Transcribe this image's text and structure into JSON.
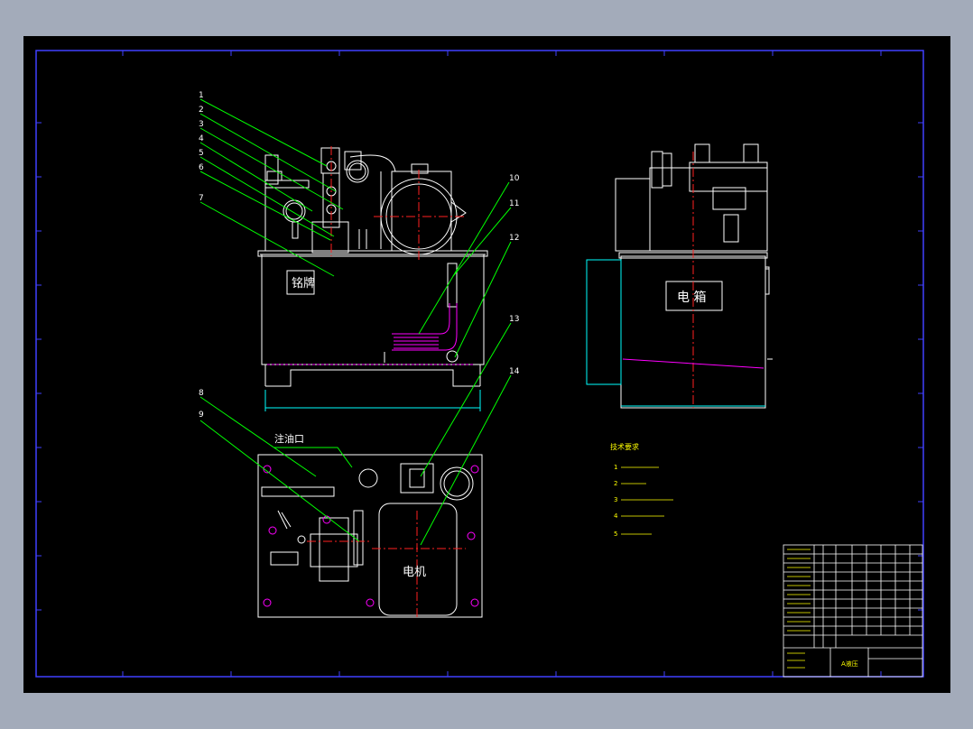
{
  "callouts": [
    {
      "n": "1"
    },
    {
      "n": "2"
    },
    {
      "n": "3"
    },
    {
      "n": "4"
    },
    {
      "n": "5"
    },
    {
      "n": "6"
    },
    {
      "n": "7"
    },
    {
      "n": "8"
    },
    {
      "n": "9"
    },
    {
      "n": "10"
    },
    {
      "n": "11"
    },
    {
      "n": "12"
    },
    {
      "n": "13"
    },
    {
      "n": "14"
    }
  ],
  "labels": {
    "nameplate": "铭牌",
    "electric_box": "电 箱",
    "motor": "电机",
    "fill_port": "注油口"
  },
  "notes": {
    "heading": "技术要求",
    "items": [
      "1",
      "2",
      "3",
      "4",
      "5"
    ]
  },
  "title_block": {
    "drawing_title": "A液压",
    "colors": {
      "frame": "#4040ff",
      "outline": "#ffffff",
      "leader": "#00ff00",
      "center": "#ff2020",
      "hidden": "#ff00ff",
      "dim": "#00ffff"
    }
  }
}
